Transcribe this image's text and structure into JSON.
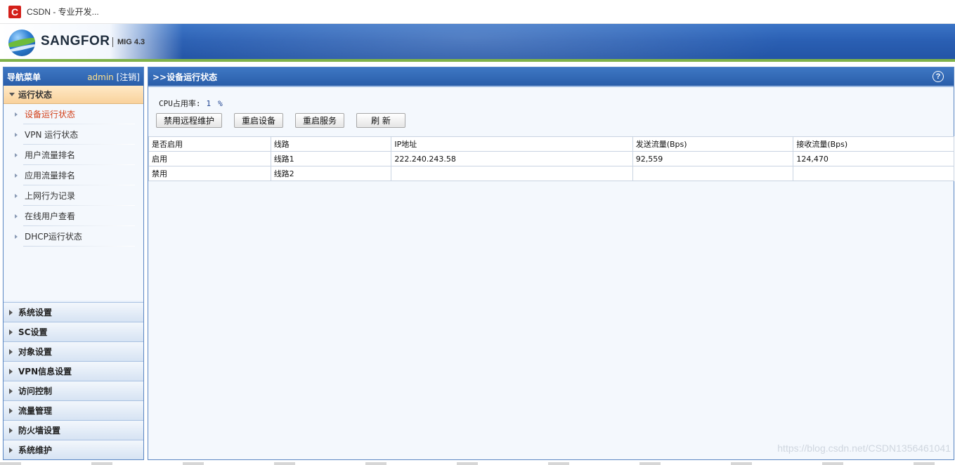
{
  "browser": {
    "tab_title": "CSDN - 专业开发...",
    "favicon_letter": "C"
  },
  "banner": {
    "brand": "SANGFOR",
    "model": "MIG 4.3"
  },
  "nav": {
    "title": "导航菜单",
    "user": "admin",
    "logout": "[注销]",
    "open_group": "运行状态",
    "items": [
      {
        "label": "设备运行状态",
        "active": true
      },
      {
        "label": "VPN 运行状态",
        "active": false
      },
      {
        "label": "用户流量排名",
        "active": false
      },
      {
        "label": "应用流量排名",
        "active": false
      },
      {
        "label": "上网行为记录",
        "active": false
      },
      {
        "label": "在线用户查看",
        "active": false
      },
      {
        "label": "DHCP运行状态",
        "active": false
      }
    ],
    "groups": [
      "系统设置",
      "SC设置",
      "对象设置",
      "VPN信息设置",
      "访问控制",
      "流量管理",
      "防火墙设置",
      "系统维护"
    ]
  },
  "main": {
    "title": ">>设备运行状态",
    "cpu_label": "CPU占用率:",
    "cpu_value": "1",
    "cpu_unit": "%",
    "buttons": [
      "禁用远程维护",
      "重启设备",
      "重启服务",
      "刷 新"
    ],
    "table": {
      "headers": [
        "是否启用",
        "线路",
        "IP地址",
        "发送流量(Bps)",
        "接收流量(Bps)"
      ],
      "rows": [
        [
          "启用",
          "线路1",
          "222.240.243.58",
          "92,559",
          "124,470"
        ],
        [
          "禁用",
          "线路2",
          "",
          "",
          ""
        ]
      ]
    }
  },
  "watermark": "https://blog.csdn.net/CSDN1356461041"
}
